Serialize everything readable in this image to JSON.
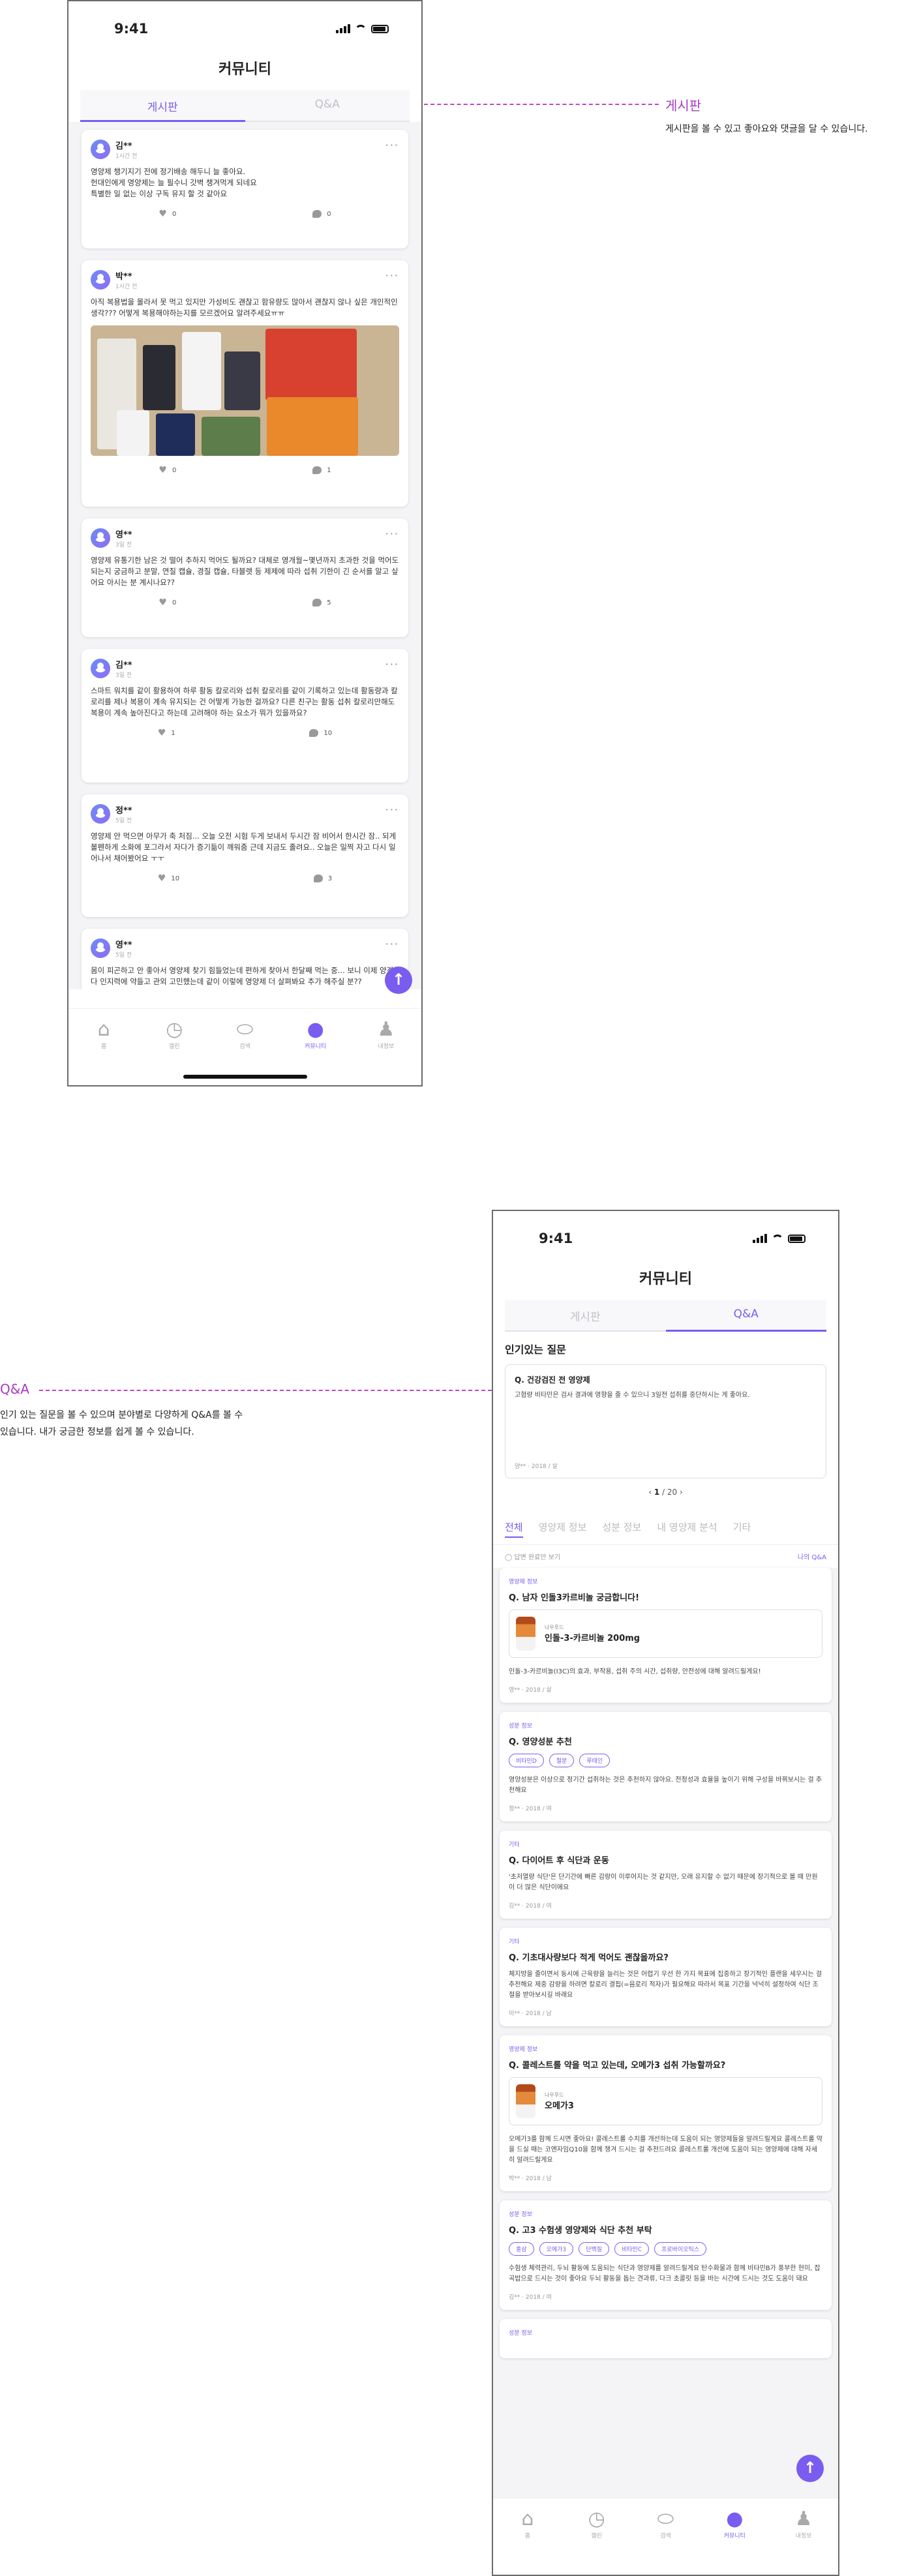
{
  "status": {
    "time": "9:41"
  },
  "screen1": {
    "title": "커뮤니티",
    "tabs": [
      "게시판",
      "Q&A"
    ],
    "posts": [
      {
        "user": "김**",
        "time": "1시간 전",
        "text": "영양제 챙기지기 전에 정기배송 해두니 늘 좋아요.\n헌대인에게 영양제는 늘 필수니 갓벽 챙겨먹게 되네요\n특별한 일 없는 이상 구독 유지 할 것 같아요",
        "likes": "0",
        "comments": "0"
      },
      {
        "user": "박**",
        "time": "1시간 전",
        "text": "아직 복용법을 몰라서 못 먹고 있지만 가성비도 괜찮고 함유량도 많아서 괜찮지 않나 싶은 개인적인 생각??? 어떻게 복용해야하는지를 모르겠어요 알려주세요ㅠㅠ",
        "likes": "0",
        "comments": "1"
      },
      {
        "user": "영**",
        "time": "3일 전",
        "text": "영양제 유통기한 남은 것 떨어 추하지 먹어도 될까요? 대체로 영개월~몇년까지 초과한 것을 먹어도 되는지 궁금하고 분말, 연질 캡슐, 경질 캡슐, 타블렛 등 제제에 따라 섭취 기한이 긴 순서를 알고 싶어요 아시는 분 계시나요??",
        "likes": "0",
        "comments": "5"
      },
      {
        "user": "김**",
        "time": "3일 전",
        "text": "스마트 워치를 같이 활용하여 하루 활동 칼로리와 섭취 칼로리를 같이 기록하고 있는데 활동량과 칼로리를 제나 복용이 계속 유지되는 건 어떻게 가능한 걸까요? 다른 친구는 활동 섭취 칼로리만해도 복용이 계속 높아진다고 하는데 고려해야 하는 요소가 뭐가 있을까요?",
        "likes": "1",
        "comments": "10"
      },
      {
        "user": "정**",
        "time": "5일 전",
        "text": "영양제 안 먹으면 아무가 축 처짐... 오늘 오전 시험 두게 보내서 두시간 잠 비어서 한시간 잠.. 되게 볼펜하게 소화에 포그라서 자다가 증기듦이 깨워줌 근데 지금도 졸려요.. 오늘은 일찍 자고 다시 일어나서 채어봤어요 ㅜㅜ",
        "likes": "10",
        "comments": "3"
      },
      {
        "user": "영**",
        "time": "5일 전",
        "text": "몸이 피곤하고 안 좋아서 영양제 찾기 힘들었는데 편하게 찾아서 한달째 먹는 중... 보니 이제 양겠다 인지력에 약들고 관외 고민했는데 같이 이렇에 영양제 더 살펴봐요 추가 해주실 분??",
        "likes": "",
        "comments": ""
      }
    ],
    "nav": [
      "홈",
      "캘린",
      "검색",
      "커뮤니티",
      "내정보"
    ]
  },
  "annotation1": {
    "title": "게시판",
    "desc": "게시판을 볼 수 있고 좋아요와 댓글을 달 수 있습니다."
  },
  "annotation2": {
    "title": "Q&A",
    "desc1": "인기 있는 질문을 볼 수 있으며 분야별로 다양하게 Q&A를 볼 수",
    "desc2": "있습니다. 내가 궁금한 정보를 쉽게 볼 수 있습니다."
  },
  "screen2": {
    "title": "커뮤니티",
    "tabs": [
      "게시판",
      "Q&A"
    ],
    "popular_heading": "인기있는 질문",
    "popular": {
      "q": "Q. 건강검진 전 영양제",
      "a": "고협량 비타민은 검사 결과에 영향을 줄 수 있으니 3일전 섭취를 중단하시는 게 좋아요.",
      "meta": "양** · 2018 / 살"
    },
    "pager": {
      "current": "1",
      "total": "/ 20"
    },
    "cats": [
      "전체",
      "영양제 정보",
      "성분 정보",
      "내 영양제 분석",
      "기타"
    ],
    "filter_left": "답변 완료만 보기",
    "filter_right": "나의 Q&A",
    "cards": [
      {
        "cat": "영양제 정보",
        "q": "Q. 남자 인돌3카르비놀 궁금합니다!",
        "brand": "나우푸드",
        "product": "인돌-3-카르비놀 200mg",
        "a": "인돌-3-카르비놀(I3C)의 효과, 부작용, 섭취 주의 시간, 섭취량, 안전성에 대해 알려드릴게요!",
        "meta": "영** · 2018 / 살"
      },
      {
        "cat": "성분 정보",
        "q": "Q. 영양성분 추천",
        "tags": [
          "비타민D",
          "철분",
          "루테인"
        ],
        "a": "영양성분은 이상으로 정기간 섭취하는 것은 추천하지 않아요. 전정성과 효율을 높이기 위해 구성을 바꿔보시는 걸 추천해요",
        "meta": "정** · 2018 / 여"
      },
      {
        "cat": "기타",
        "q": "Q. 다이어트 후 식단과 운동",
        "a": "'초저열량 식단'은 단기간에 빠른 감량이 이루어지는 것 같지만, 오래 유지할 수 없기 때문에 장기적으로 볼 때 만원이 더 많은 식단이에요",
        "meta": "김** · 2018 / 여"
      },
      {
        "cat": "기타",
        "q": "Q. 기초대사량보다 적게 먹어도 괜찮을까요?",
        "a": "체지방을 줄이면서 동시에 근육량을 늘리는 것은 어렵기 우선 한 가지 목표에 집중하고 장기적인 플랜을 세우시는 걸 추천해요 제중 감량을 하려면 칼로리 결핍(=음로리 적자)가 필요해요 따라서 목표 기간을 넉넉히 설정하여 식단 조절을 받아보시길 바래요",
        "meta": "이** · 2018 / 남"
      },
      {
        "cat": "영양제 정보",
        "q": "Q. 콜레스트롤 약을 먹고 있는데, 오메가3 섭취 가능할까요?",
        "brand": "나우푸드",
        "product": "오메가3",
        "a": "오메가3를 함께 드시면 좋아요! 콜레스트롤 수치를 개선하는데 도움이 되는 영양제들을 알려드릴게요 콜레스트롤 약을 드실 때는 코엔자임Q10을 함께 챙겨 드시는 걸 추천드려요 콜레스트롤 개선에 도움이 되는 영양제에 대해 자세히 알려드릴게요",
        "meta": "박** · 2018 / 남"
      },
      {
        "cat": "성분 정보",
        "q": "Q. 고3 수험생 영양제와 식단 추천 부탁",
        "tags": [
          "홍삼",
          "오메가3",
          "단백질",
          "비타민C",
          "프로바이오틱스"
        ],
        "a": "수험생 체력관리, 두뇌 활동에 도움되는 식단과 영양제를 알려드릴게요 탄수화물과 함께 비타민B가 풍부한 현미, 잡곡밥으로 드시는 것이 좋아요 두뇌 활동을 돕는 견과류, 다크 초콜릿 등을 바는 시간에 드시는 것도 도움이 돼요",
        "meta": "김** · 2018 / 여"
      },
      {
        "cat": "성분 정보"
      }
    ],
    "nav": [
      "홈",
      "캘린",
      "검색",
      "커뮤니티",
      "내정보"
    ]
  }
}
